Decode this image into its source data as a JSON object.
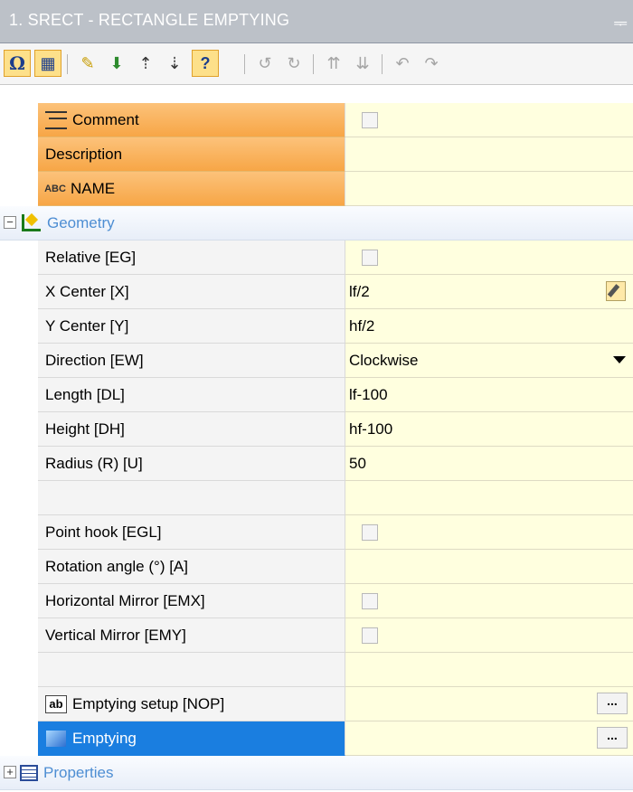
{
  "window": {
    "title": "1. SRECT - RECTANGLE EMPTYING",
    "pin_glyph": "ᆕ"
  },
  "toolbar": {
    "buttons": [
      {
        "name": "omega-icon",
        "glyph": "Ω",
        "active": true
      },
      {
        "name": "grid-icon",
        "glyph": "▦",
        "active": true
      },
      {
        "name": "new-icon",
        "glyph": "✎"
      },
      {
        "name": "import-icon",
        "glyph": "⬇"
      },
      {
        "name": "move-up-icon",
        "glyph": "⇡"
      },
      {
        "name": "move-down-icon",
        "glyph": "⇣"
      },
      {
        "name": "help-icon",
        "glyph": "?",
        "active": true
      },
      {
        "name": "rotate-left-icon",
        "glyph": "↺"
      },
      {
        "name": "rotate-right-icon",
        "glyph": "↻"
      },
      {
        "name": "sort-up-icon",
        "glyph": "⇈"
      },
      {
        "name": "sort-down-icon",
        "glyph": "⇊"
      },
      {
        "name": "undo-icon",
        "glyph": "↶"
      },
      {
        "name": "redo-icon",
        "glyph": "↷"
      }
    ]
  },
  "rows": {
    "comment": {
      "label": "Comment"
    },
    "description": {
      "label": "Description"
    },
    "name": {
      "label": "NAME",
      "icon_text": "ABC"
    },
    "geometry": {
      "label": "Geometry"
    },
    "relative": {
      "label": "Relative [EG]"
    },
    "x_center": {
      "label": "X Center [X]",
      "value": "lf/2"
    },
    "y_center": {
      "label": "Y Center [Y]",
      "value": "hf/2"
    },
    "direction": {
      "label": "Direction [EW]",
      "value": "Clockwise"
    },
    "length": {
      "label": "Length [DL]",
      "value": "lf-100"
    },
    "height": {
      "label": "Height [DH]",
      "value": "hf-100"
    },
    "radius": {
      "label": "Radius (R) [U]",
      "value": "50"
    },
    "point_hook": {
      "label": "Point hook [EGL]"
    },
    "rotation": {
      "label": "Rotation angle (°) [A]"
    },
    "hmirror": {
      "label": "Horizontal Mirror [EMX]"
    },
    "vmirror": {
      "label": "Vertical Mirror [EMY]"
    },
    "emptying_setup": {
      "label": "Emptying setup [NOP]",
      "icon_text": "ab",
      "button": "..."
    },
    "emptying": {
      "label": "Emptying",
      "button": "..."
    },
    "properties": {
      "label": "Properties"
    }
  },
  "expanders": {
    "minus": "−",
    "plus": "+"
  }
}
